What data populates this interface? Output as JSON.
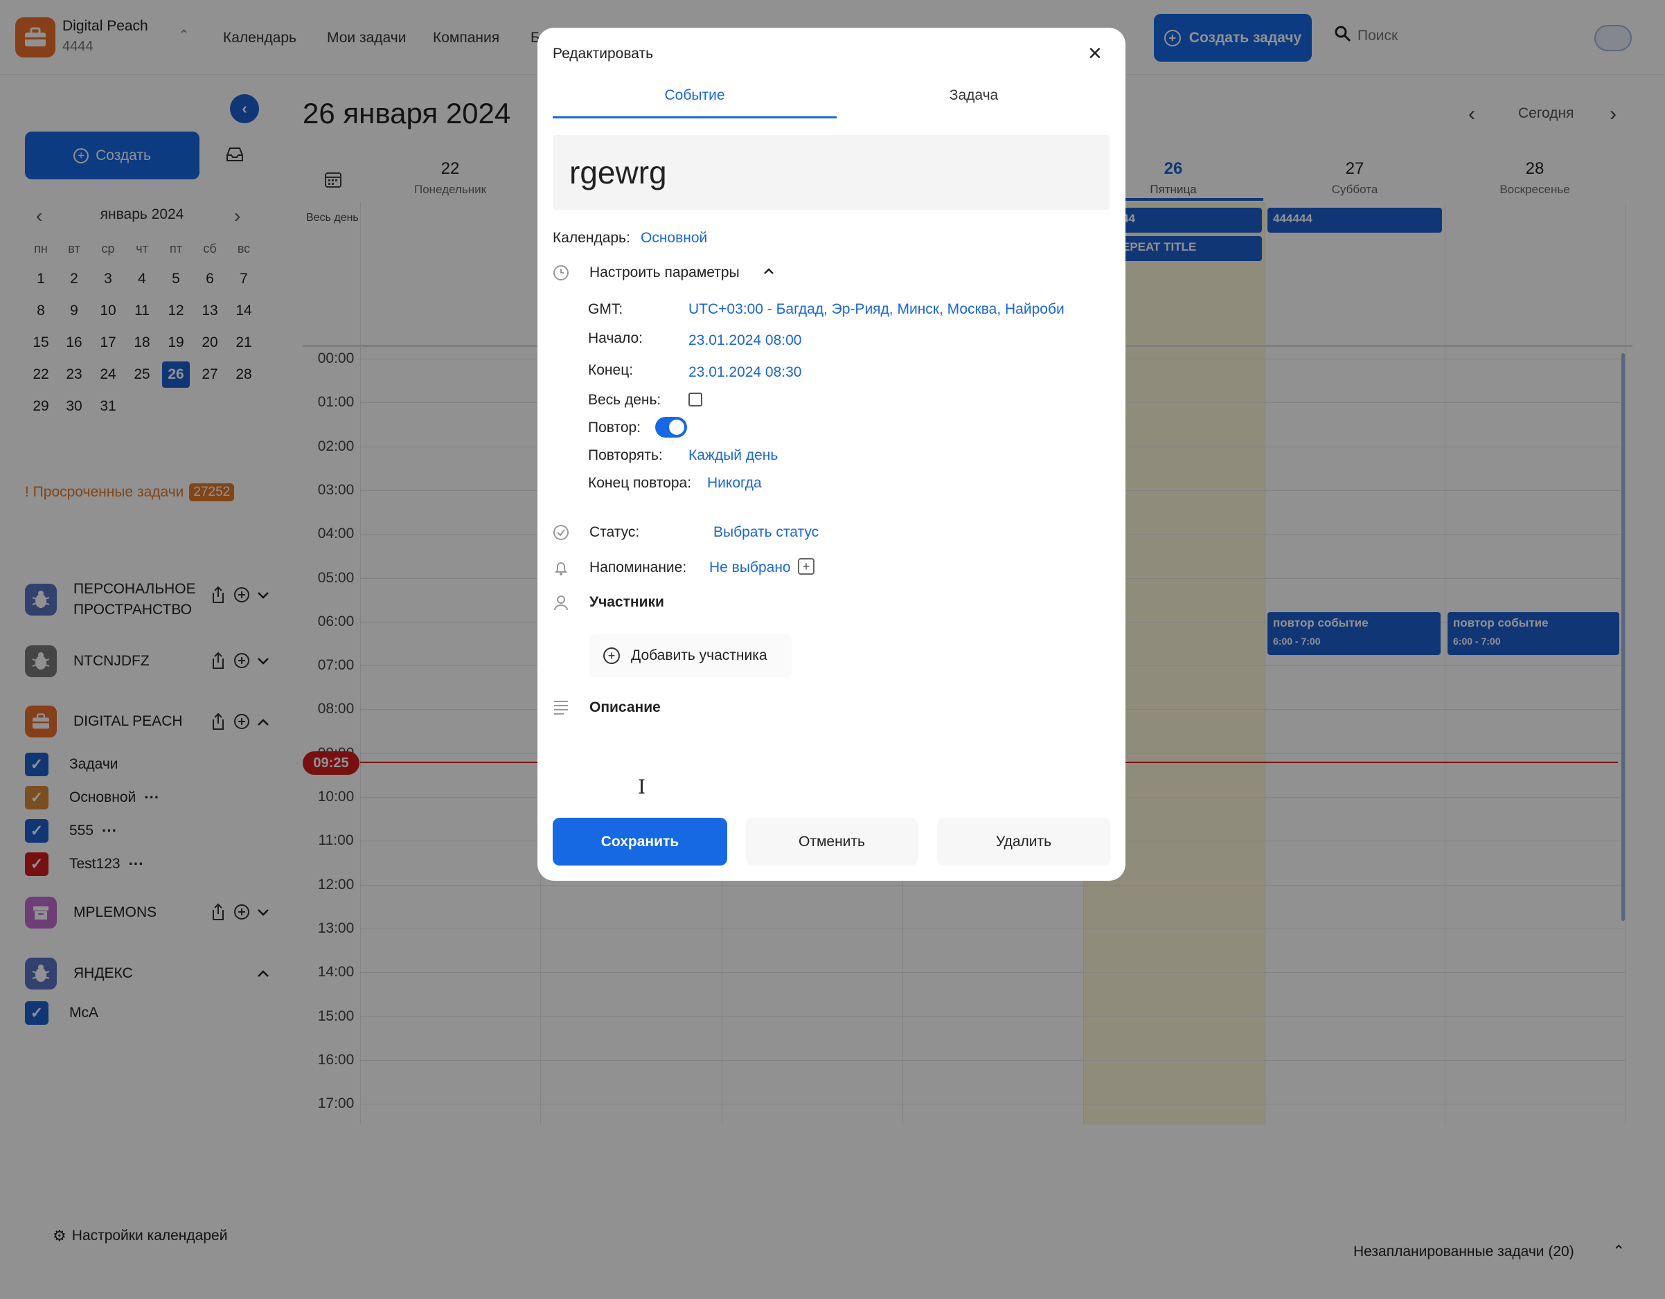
{
  "topbar": {
    "company_name": "Digital Peach",
    "company_id": "4444",
    "nav": [
      "Календарь",
      "Мои задачи",
      "Компания",
      "Б"
    ],
    "create_task_label": "Создать задачу",
    "search_placeholder": "Поиск"
  },
  "sidebar": {
    "create_label": "Создать",
    "month_label": "январь 2024",
    "weekdays": [
      "пн",
      "вт",
      "ср",
      "чт",
      "пт",
      "сб",
      "вс"
    ],
    "weeks": [
      [
        "1",
        "2",
        "3",
        "4",
        "5",
        "6",
        "7"
      ],
      [
        "8",
        "9",
        "10",
        "11",
        "12",
        "13",
        "14"
      ],
      [
        "15",
        "16",
        "17",
        "18",
        "19",
        "20",
        "21"
      ],
      [
        "22",
        "23",
        "24",
        "25",
        "26",
        "27",
        "28"
      ],
      [
        "29",
        "30",
        "31",
        "",
        "",
        "",
        ""
      ]
    ],
    "selected_day": "26",
    "overdue_label": "! Просроченные задачи",
    "overdue_count": "27252",
    "projects": [
      {
        "name": "ПЕРСОНАЛЬНОЕ ПРОСТРАНСТВО",
        "name_line1": "ПЕРСОНАЛЬНОЕ",
        "name_line2": "ПРОСТРАНСТВО",
        "icon": "bug-icon",
        "color": "#5a73c4"
      },
      {
        "name": "NTCNJDFZ",
        "icon": "bug-icon",
        "color": "#7a7a7a"
      },
      {
        "name": "DIGITAL PEACH",
        "icon": "briefcase-icon",
        "color": "#ee6f2d"
      },
      {
        "name": "MPLEMONS",
        "icon": "archive-icon",
        "color": "#c06bd0"
      },
      {
        "name": "ЯНДЕКС",
        "icon": "bug-icon",
        "color": "#5a73c4"
      }
    ],
    "digital_peach_calendars": [
      {
        "label": "Задачи",
        "color": "#1f5fcf"
      },
      {
        "label": "Основной",
        "color": "#d98a3a"
      },
      {
        "label": "555",
        "color": "#1f5fcf"
      },
      {
        "label": "Test123",
        "color": "#d11f1f"
      }
    ],
    "yandex_calendars": [
      {
        "label": "McA",
        "color": "#1f5fcf"
      }
    ],
    "settings_label": "Настройки календарей"
  },
  "calendar": {
    "title": "26 января 2024",
    "today_label": "Сегодня",
    "allday_label": "Весь день",
    "days": [
      {
        "num": "22",
        "name": "Понедельник"
      },
      {
        "num": "26",
        "name": "Пятница"
      },
      {
        "num": "27",
        "name": "Суббота"
      },
      {
        "num": "28",
        "name": "Воскресенье"
      }
    ],
    "times": [
      "00:00",
      "01:00",
      "02:00",
      "03:00",
      "04:00",
      "05:00",
      "06:00",
      "07:00",
      "08:00",
      "09:00",
      "10:00",
      "11:00",
      "12:00",
      "13:00",
      "14:00",
      "15:00",
      "16:00",
      "17:00"
    ],
    "current_time": "09:25",
    "allday_events": [
      {
        "title": "44"
      },
      {
        "title": "EPEAT TITLE"
      },
      {
        "title": "444444"
      }
    ],
    "events": [
      {
        "title": "повтор событие",
        "time": "6:00 - 7:00"
      },
      {
        "title": "повтор событие",
        "time": "6:00 - 7:00"
      }
    ],
    "unscheduled_label": "Незапланированные задачи (20)"
  },
  "modal": {
    "title": "Редактировать",
    "tabs": [
      "Событие",
      "Задача"
    ],
    "active_tab": "Событие",
    "event_name": "rgewrg",
    "calendar_label": "Календарь:",
    "calendar_value": "Основной",
    "params_label": "Настроить параметры",
    "gmt_label": "GMT:",
    "gmt_value": "UTC+03:00 - Багдад, Эр-Рияд, Минск, Москва, Найроби",
    "start_label": "Начало:",
    "start_value": "23.01.2024 08:00",
    "end_label": "Конец:",
    "end_value": "23.01.2024 08:30",
    "allday_label": "Весь день:",
    "allday_checked": false,
    "repeat_label": "Повтор:",
    "repeat_on": true,
    "repeat_every_label": "Повторять:",
    "repeat_every_value": "Каждый день",
    "repeat_end_label": "Конец повтора:",
    "repeat_end_value": "Никогда",
    "status_label": "Статус:",
    "status_value": "Выбрать статус",
    "reminder_label": "Напоминание:",
    "reminder_value": "Не выбрано",
    "participants_label": "Участники",
    "add_participant_label": "Добавить участника",
    "description_label": "Описание",
    "save_label": "Сохранить",
    "cancel_label": "Отменить",
    "delete_label": "Удалить",
    "accent_color": "#1668e3"
  }
}
